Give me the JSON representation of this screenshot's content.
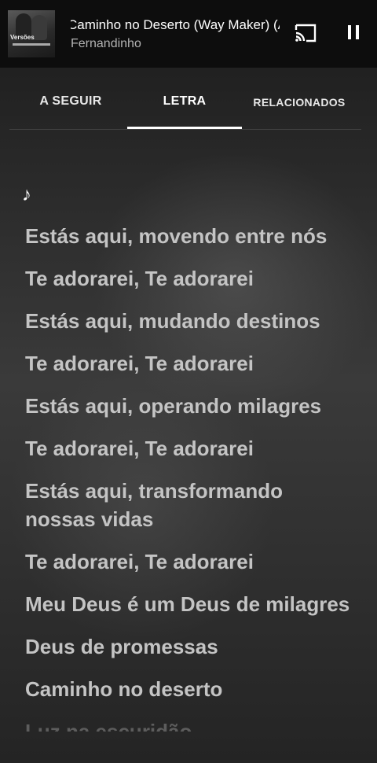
{
  "player": {
    "song_title": "Caminho no Deserto (Way Maker) (Ao Vivo)",
    "artist": "Fernandinho",
    "thumbnail_text": "Versões",
    "cast_icon": "cast-icon",
    "pause_icon": "pause-icon"
  },
  "tabs": [
    {
      "label": "A SEGUIR",
      "selected": false
    },
    {
      "label": "LETRA",
      "selected": true
    },
    {
      "label": "RELACIONADOS",
      "selected": false
    }
  ],
  "lyrics": {
    "note_icon": "♪",
    "lines": [
      "Estás aqui, movendo entre nós",
      "Te adorarei, Te adorarei",
      "Estás aqui, mudando destinos",
      "Te adorarei, Te adorarei",
      "Estás aqui, operando milagres",
      "Te adorarei, Te adorarei",
      "Estás aqui, transformando nossas vidas",
      "Te adorarei, Te adorarei",
      "Meu Deus é um Deus de milagres",
      "Deus de promessas",
      "Caminho no deserto",
      "Luz na escuridão"
    ]
  }
}
